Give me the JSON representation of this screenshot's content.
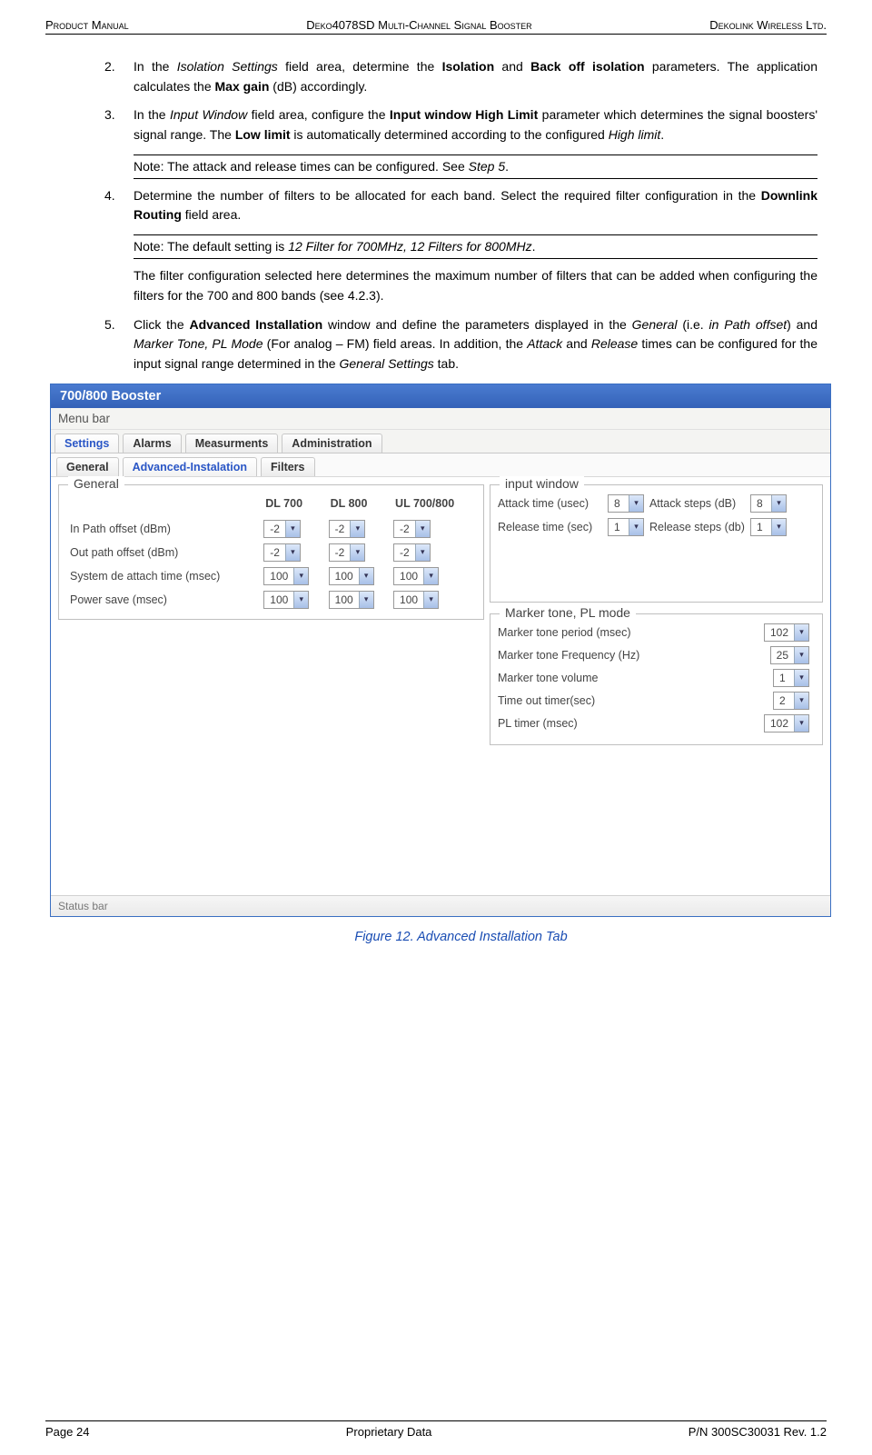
{
  "header": {
    "left": "Product Manual",
    "center": "Deko4078SD Multi-Channel Signal Booster",
    "right": "Dekolink Wireless Ltd."
  },
  "items": {
    "i2": {
      "num": "2.",
      "text_parts": [
        "In the ",
        "Isolation Settings",
        " field area, determine the ",
        "Isolation",
        " and ",
        "Back off isolation",
        " parameters. The application calculates the ",
        "Max gain",
        " (dB) accordingly."
      ]
    },
    "i3": {
      "num": "3.",
      "text_parts": [
        "In the ",
        "Input Window",
        " field area, configure the ",
        "Input window High Limit",
        " parameter which determines the signal boosters' signal range. The ",
        "Low limit",
        " is automatically determined according to the configured ",
        "High limit",
        "."
      ]
    },
    "note1": [
      "Note: The attack and release times can be configured. See ",
      "Step 5",
      "."
    ],
    "i4": {
      "num": "4.",
      "text": "Determine the number of filters to be allocated for each band. Select the required filter configuration in the ",
      "bold": "Downlink Routing",
      "tail": " field area."
    },
    "note2": [
      "Note: The default setting is ",
      "12 Filter for 700MHz, 12 Filters for 800MHz",
      "."
    ],
    "sub4": "The filter configuration selected here determines the maximum number of filters that can be added when configuring the filters for the 700 and 800 bands (see 4.2.3).",
    "i5": {
      "num": "5.",
      "parts": [
        "Click the ",
        "Advanced Installation",
        " window and define the parameters displayed in the ",
        "General",
        " (i.e. ",
        "in Path offset",
        ") and ",
        "Marker Tone, PL Mode",
        " (For analog – FM) field areas. In addition, the ",
        "Attack",
        " and ",
        "Release",
        " times can be configured for the input signal range determined in the ",
        "General Settings",
        " tab."
      ]
    }
  },
  "screenshot": {
    "title": "700/800 Booster",
    "menubar": "Menu bar",
    "tabs": [
      "Settings",
      "Alarms",
      "Measurments",
      "Administration"
    ],
    "subtabs": [
      "General",
      "Advanced-Instalation",
      "Filters"
    ],
    "active_tab": 0,
    "active_subtab": 1,
    "general": {
      "title": "General",
      "cols": [
        "",
        "DL 700",
        "DL 800",
        "UL 700/800"
      ],
      "rows": [
        {
          "label": "In Path offset   (dBm)",
          "vals": [
            "-2",
            "-2",
            "-2"
          ]
        },
        {
          "label": "Out path offset (dBm)",
          "vals": [
            "-2",
            "-2",
            "-2"
          ]
        },
        {
          "label": "System de attach time (msec)",
          "vals": [
            "100",
            "100",
            "100"
          ]
        },
        {
          "label": "Power save (msec)",
          "vals": [
            "100",
            "100",
            "100"
          ]
        }
      ]
    },
    "input_window": {
      "title": "input window",
      "rows": [
        {
          "l1": "Attack time (usec)",
          "v1": "8",
          "l2": "Attack steps (dB)",
          "v2": "8"
        },
        {
          "l1": "Release time (sec)",
          "v1": "1",
          "l2": "Release steps (db)",
          "v2": "1"
        }
      ]
    },
    "marker": {
      "title": "Marker tone, PL mode",
      "rows": [
        {
          "label": "Marker tone period (msec)",
          "val": "102"
        },
        {
          "label": "Marker tone Frequency (Hz)",
          "val": "25"
        },
        {
          "label": "Marker tone volume",
          "val": "1"
        },
        {
          "label": "Time out timer(sec)",
          "val": "2"
        },
        {
          "label": "PL timer (msec)",
          "val": "102"
        }
      ]
    },
    "status": "Status bar"
  },
  "figcaption": "Figure 12. Advanced Installation Tab",
  "footer": {
    "left": "Page 24",
    "center": "Proprietary Data",
    "right": "P/N 300SC30031 Rev. 1.2"
  }
}
